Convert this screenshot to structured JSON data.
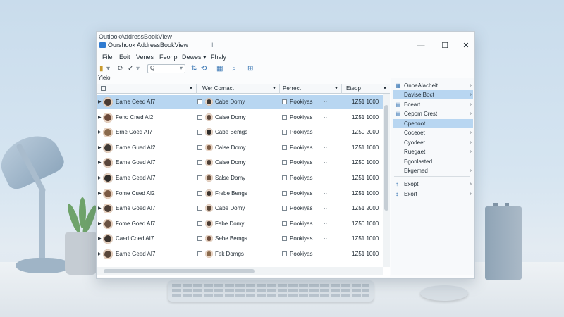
{
  "outer_title": "OutlookAddressBookView",
  "window": {
    "title": "Ourshook AddressBookView",
    "title_mark": "I",
    "minimize": "—",
    "maximize": "☐",
    "close": "✕"
  },
  "menubar": [
    "File",
    "Eoit",
    "Venes",
    "Feonp",
    "Dewes ▾",
    "Fhaly"
  ],
  "toolbar": {
    "search_placeholder": "Q"
  },
  "view_label": "Yieio",
  "columns": {
    "name": "",
    "contact": "Wer Cornact",
    "product": "Perrect",
    "extra": "Eteop"
  },
  "rows": [
    {
      "name": "Eame Ceed AI7",
      "contact": "Cabe Domy",
      "product": "Pookiyas",
      "dot": "··",
      "num": "1Z51 1000",
      "selected": true
    },
    {
      "name": "Feno Cned AI2",
      "contact": "Calse Domy",
      "product": "Pookiyas",
      "dot": "··",
      "num": "1Z51 1000",
      "selected": false
    },
    {
      "name": "Erne Coed AI7",
      "contact": "Cabe Bemgs",
      "product": "Pookiyas",
      "dot": "··",
      "num": "1Z50 2000",
      "selected": false
    },
    {
      "name": "Eame Gued AI2",
      "contact": "Calse Domy",
      "product": "Pookiyas",
      "dot": "··",
      "num": "1Z51 1000",
      "selected": false
    },
    {
      "name": "Eame Goed AI7",
      "contact": "Calse Domy",
      "product": "Pookiyas",
      "dot": "··",
      "num": "1Z50 1000",
      "selected": false
    },
    {
      "name": "Eame Geed AI7",
      "contact": "Salse Domy",
      "product": "Pookiyas",
      "dot": "··",
      "num": "1Z51 1000",
      "selected": false
    },
    {
      "name": "Fome Cued AI2",
      "contact": "Frebe Bengs",
      "product": "Pookiyas",
      "dot": "··",
      "num": "1Z51 1000",
      "selected": false
    },
    {
      "name": "Eame Goed AI7",
      "contact": "Cabe Domy",
      "product": "Pookiyas",
      "dot": "··",
      "num": "1Z51 2000",
      "selected": false
    },
    {
      "name": "Fome Goed AI7",
      "contact": "Fabe Domy",
      "product": "Pookiyas",
      "dot": "··",
      "num": "1Z50 1000",
      "selected": false
    },
    {
      "name": "Caed Coed AI7",
      "contact": "Sebe Bemgs",
      "product": "Pookiyas",
      "dot": "··",
      "num": "1Z51 1000",
      "selected": false
    },
    {
      "name": "Eame Geed AI7",
      "contact": "Fek Domgs",
      "product": "Pookiyas",
      "dot": "··",
      "num": "1Z51 1000",
      "selected": false
    }
  ],
  "context_menu": [
    {
      "label": "OnpeAlacheit",
      "icon": "▦",
      "arrow": "›"
    },
    {
      "label": "Davise Boct",
      "icon": "",
      "arrow": "›"
    },
    {
      "label": "Eceart",
      "icon": "▤",
      "arrow": "›"
    },
    {
      "label": "Cepom Crest",
      "icon": "▤",
      "arrow": "›"
    },
    {
      "label": "Cpenoot",
      "icon": "",
      "arrow": ""
    },
    {
      "label": "Coceoet",
      "icon": "",
      "arrow": "›"
    },
    {
      "label": "Cyodeet",
      "icon": "",
      "arrow": "›"
    },
    {
      "label": "Ruegaet",
      "icon": "",
      "arrow": "›"
    },
    {
      "label": "Egonlasted",
      "icon": "",
      "arrow": ""
    },
    {
      "label": "Ekgemed",
      "icon": "",
      "arrow": "›"
    },
    {
      "label": "Exopt",
      "icon": "↑",
      "arrow": "›"
    },
    {
      "label": "Exort",
      "icon": "↕",
      "arrow": "›"
    }
  ]
}
